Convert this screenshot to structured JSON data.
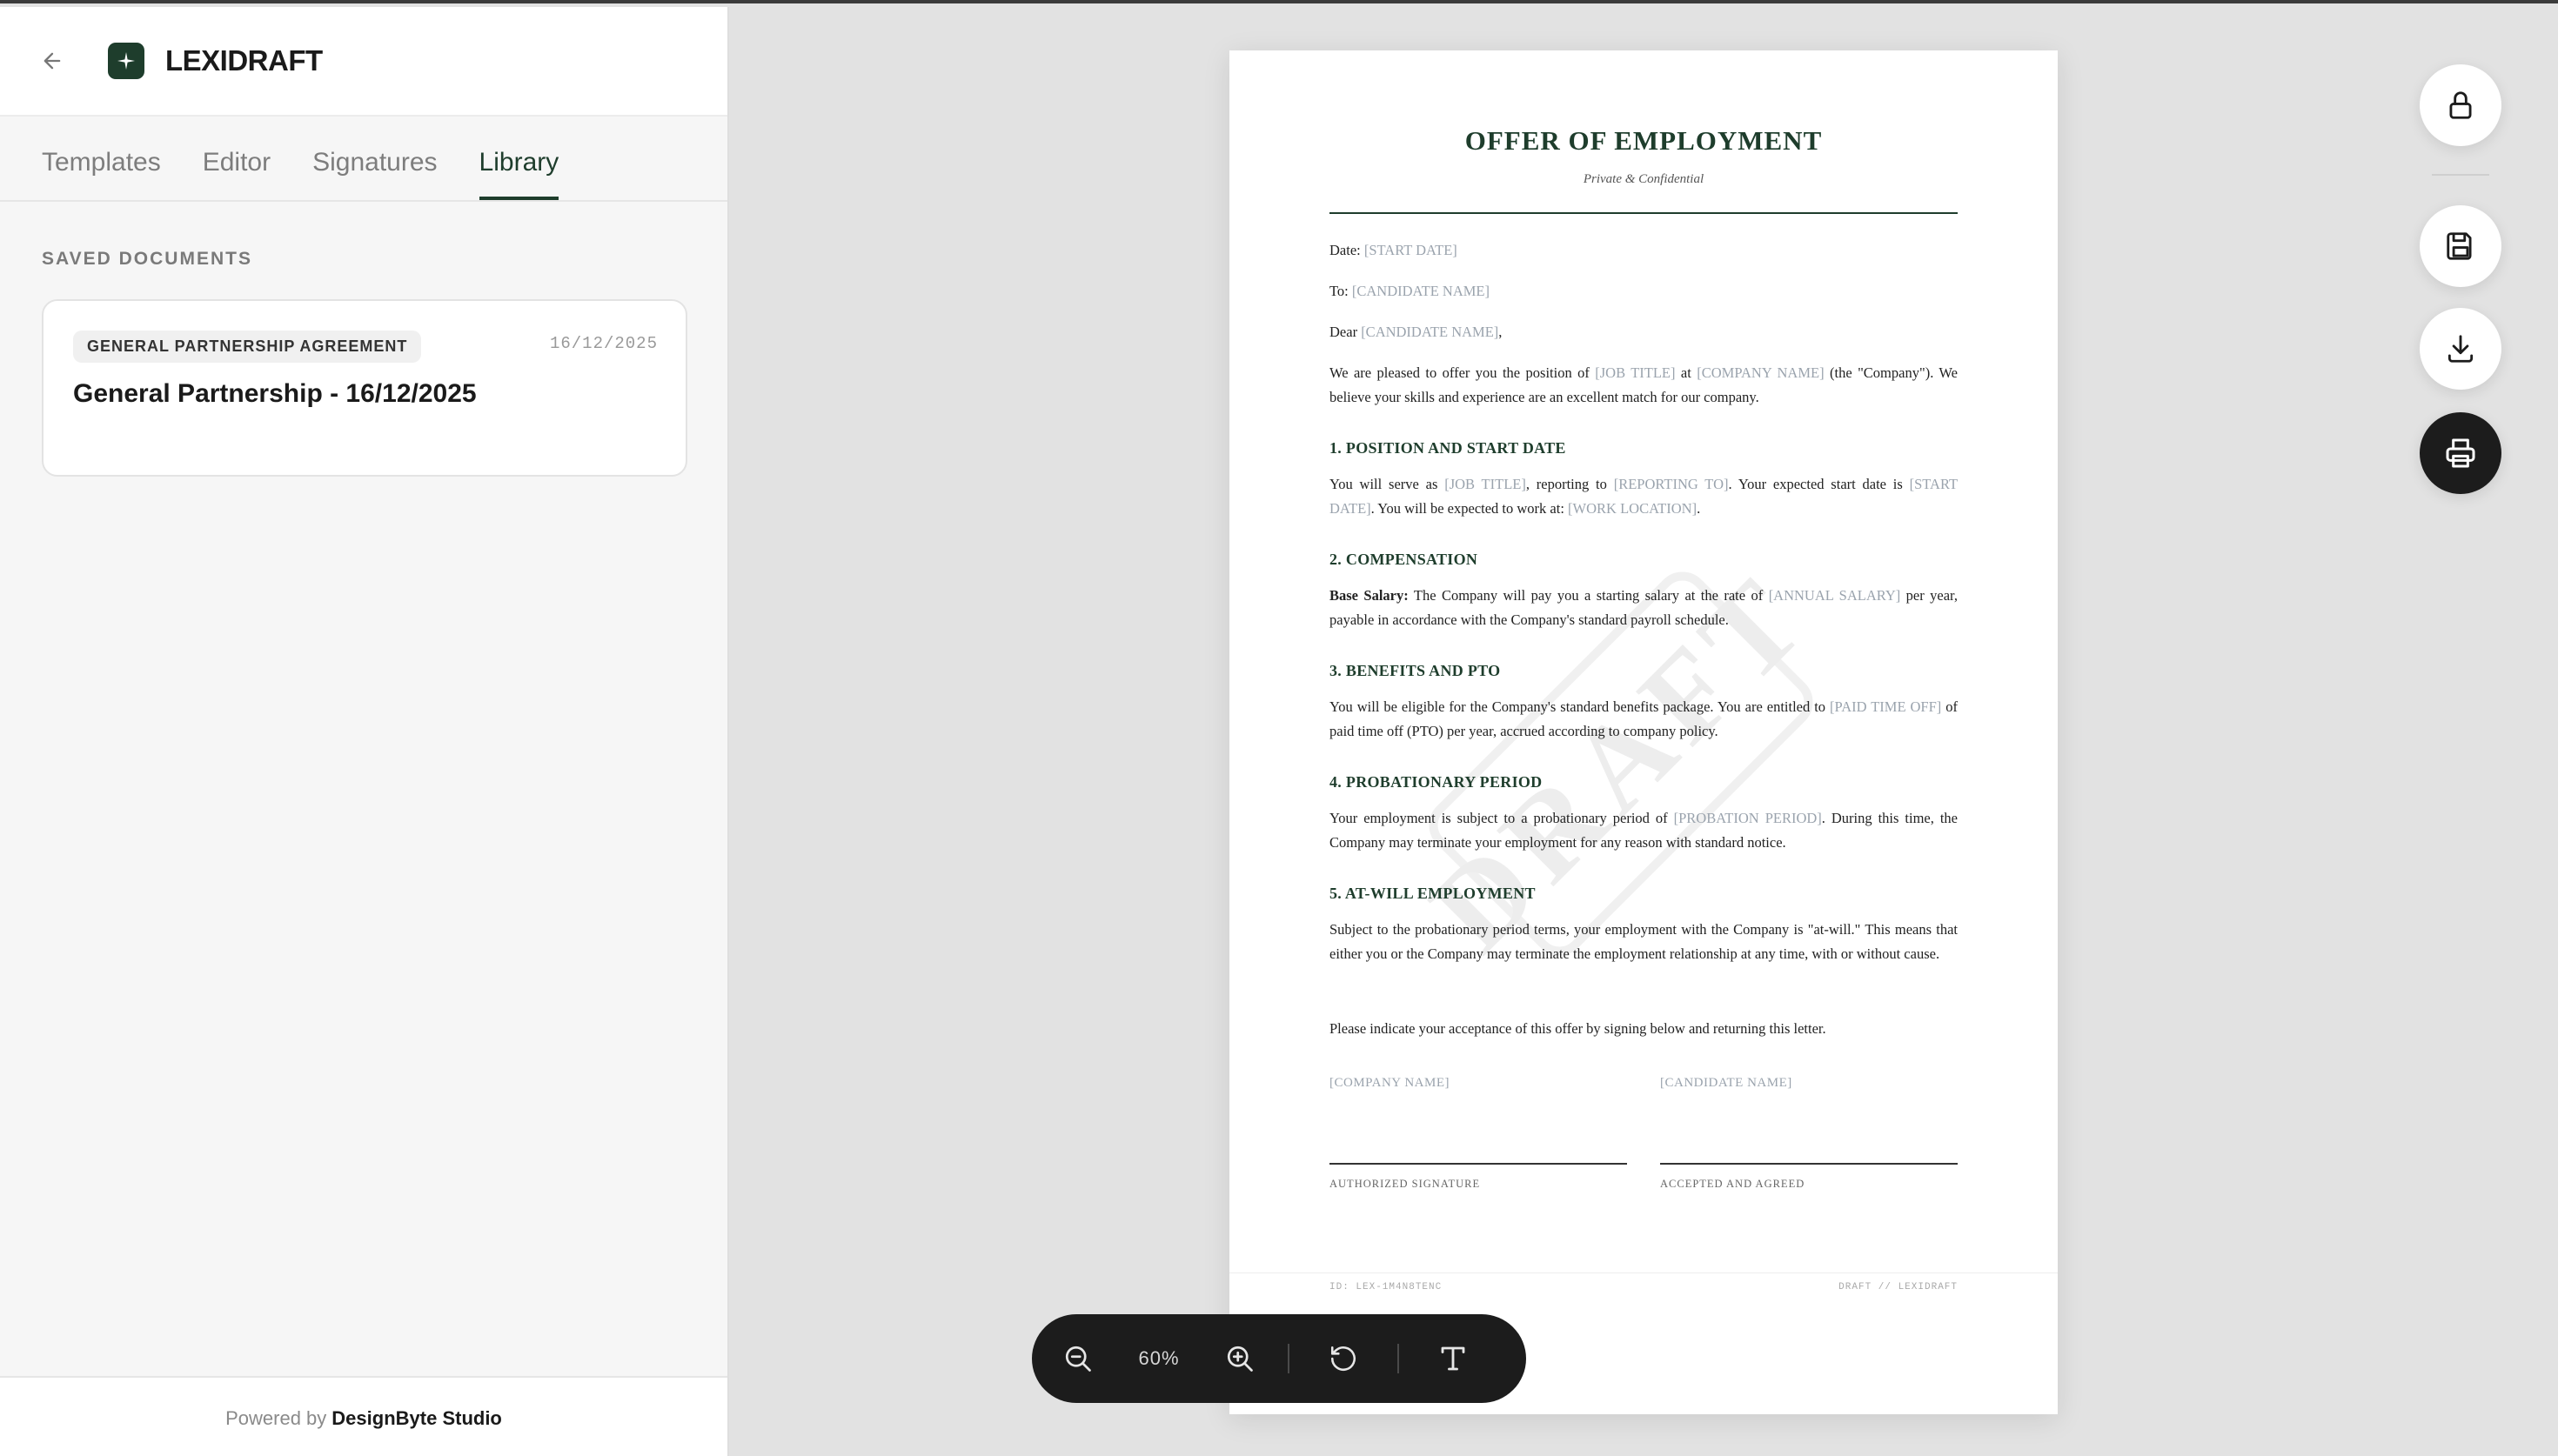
{
  "app": {
    "brand": "LEXIDRAFT"
  },
  "tabs": [
    {
      "label": "Templates"
    },
    {
      "label": "Editor"
    },
    {
      "label": "Signatures"
    },
    {
      "label": "Library"
    }
  ],
  "library": {
    "section_label": "SAVED DOCUMENTS",
    "documents": [
      {
        "tag": "GENERAL PARTNERSHIP AGREEMENT",
        "date": "16/12/2025",
        "title": "General Partnership - 16/12/2025"
      }
    ]
  },
  "footer": {
    "prefix": "Powered by",
    "company": "DesignByte Studio"
  },
  "document": {
    "title": "OFFER OF EMPLOYMENT",
    "subtitle": "Private & Confidential",
    "watermark": "DRAFT",
    "date_label": "Date:",
    "date_ph": "[START DATE]",
    "to_label": "To:",
    "to_ph": "[CANDIDATE NAME]",
    "dear_label": "Dear",
    "dear_ph": "[CANDIDATE NAME]",
    "dear_end": ",",
    "intro_1": "We are pleased to offer you the position of",
    "intro_job": "[JOB TITLE]",
    "intro_2": "at",
    "intro_company": "[COMPANY NAME]",
    "intro_3": "(the \"Company\"). We believe your skills and experience are an excellent match for our company.",
    "s1_title": "1. POSITION AND START DATE",
    "s1_a": "You will serve as",
    "s1_job": "[JOB TITLE]",
    "s1_b": ", reporting to",
    "s1_rep": "[REPORTING TO]",
    "s1_c": ". Your expected start date is",
    "s1_start": "[START DATE]",
    "s1_d": ". You will be expected to work at:",
    "s1_loc": "[WORK LOCATION]",
    "s1_e": ".",
    "s2_title": "2. COMPENSATION",
    "s2_bold": "Base Salary:",
    "s2_a": "The Company will pay you a starting salary at the rate of",
    "s2_sal": "[ANNUAL SALARY]",
    "s2_b": "per year, payable in accordance with the Company's standard payroll schedule.",
    "s3_title": "3. BENEFITS AND PTO",
    "s3_a": "You will be eligible for the Company's standard benefits package. You are entitled to",
    "s3_pto": "[PAID TIME OFF]",
    "s3_b": "of paid time off (PTO) per year, accrued according to company policy.",
    "s4_title": "4. PROBATIONARY PERIOD",
    "s4_a": "Your employment is subject to a probationary period of",
    "s4_per": "[PROBATION PERIOD]",
    "s4_b": ". During this time, the Company may terminate your employment for any reason with standard notice.",
    "s5_title": "5. AT-WILL EMPLOYMENT",
    "s5_text": "Subject to the probationary period terms, your employment with the Company is \"at-will.\" This means that either you or the Company may terminate the employment relationship at any time, with or without cause.",
    "acceptance": "Please indicate your acceptance of this offer by signing below and returning this letter.",
    "sig_left_name": "[COMPANY NAME]",
    "sig_left_caption": "AUTHORIZED SIGNATURE",
    "sig_right_name": "[CANDIDATE NAME]",
    "sig_right_caption": "ACCEPTED AND AGREED",
    "footer_left": "ID: LEX-1M4N8TENC",
    "footer_right": "DRAFT // LEXIDRAFT"
  },
  "zoom": {
    "value": "60%"
  },
  "icons": {
    "back": "arrow-left-icon",
    "logo": "sparkle-icon",
    "lock": "lock-icon",
    "save": "floppy-disk-icon",
    "download": "download-icon",
    "print": "printer-icon",
    "zoom_out": "zoom-out-icon",
    "zoom_in": "zoom-in-icon",
    "reset": "rotate-ccw-icon",
    "text": "text-icon"
  },
  "colors": {
    "brand_green": "#1e3d2c",
    "dark": "#1c1c1c",
    "placeholder": "#9aa3ad"
  }
}
